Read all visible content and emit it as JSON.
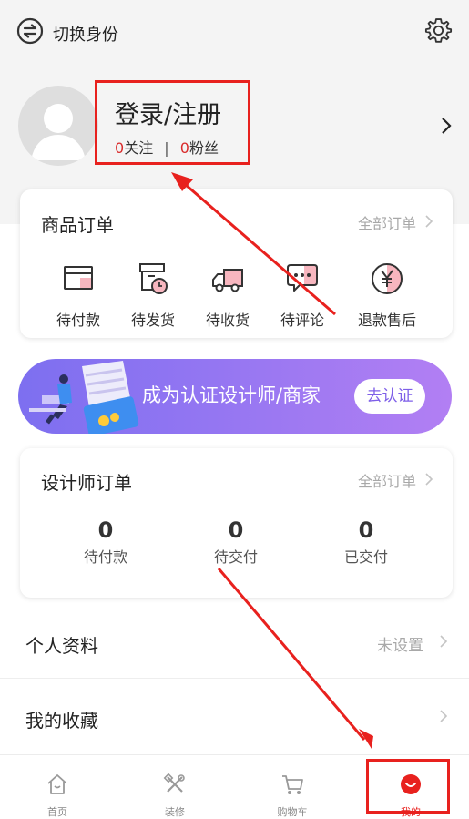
{
  "header": {
    "switch_label": "切换身份"
  },
  "profile": {
    "login_label": "登录/注册",
    "follow_count": "0",
    "follow_label": "关注",
    "separator": "|",
    "fans_count": "0",
    "fans_label": "粉丝"
  },
  "product_orders": {
    "title": "商品订单",
    "all_label": "全部订单",
    "items": [
      {
        "label": "待付款",
        "icon": "wallet-icon"
      },
      {
        "label": "待发货",
        "icon": "box-clock-icon"
      },
      {
        "label": "待收货",
        "icon": "truck-icon"
      },
      {
        "label": "待评论",
        "icon": "chat-bubble-icon"
      },
      {
        "label": "退款售后",
        "icon": "yen-coin-icon"
      }
    ]
  },
  "banner": {
    "text": "成为认证设计师/商家",
    "button_label": "去认证"
  },
  "designer_orders": {
    "title": "设计师订单",
    "all_label": "全部订单",
    "stats": [
      {
        "value": "0",
        "label": "待付款"
      },
      {
        "value": "0",
        "label": "待交付"
      },
      {
        "value": "0",
        "label": "已交付"
      }
    ]
  },
  "menu": {
    "profile_label": "个人资料",
    "profile_value": "未设置",
    "favorites_label": "我的收藏"
  },
  "tabbar": {
    "items": [
      {
        "label": "首页",
        "icon": "home-icon"
      },
      {
        "label": "装修",
        "icon": "tools-icon"
      },
      {
        "label": "购物车",
        "icon": "cart-icon"
      },
      {
        "label": "我的",
        "icon": "smile-icon"
      }
    ],
    "active_index": 3
  },
  "colors": {
    "accent_red": "#e8211e",
    "banner_purple": "#8b72f1",
    "muted_grey": "#a8a8a8"
  }
}
